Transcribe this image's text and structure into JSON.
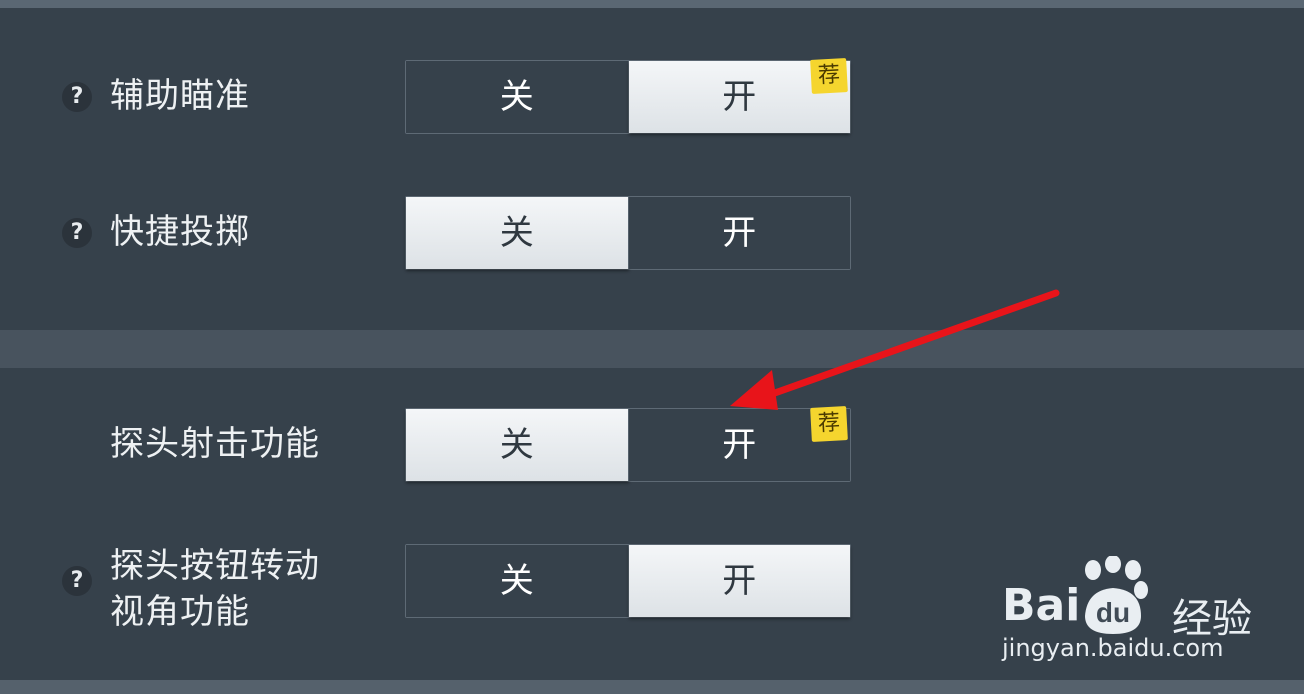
{
  "settings": [
    {
      "label_lines": [
        "辅助瞄准"
      ],
      "help": "?",
      "off": "关",
      "on": "开",
      "selected": "on",
      "badge": "荐"
    },
    {
      "label_lines": [
        "快捷投掷"
      ],
      "help": "?",
      "off": "关",
      "on": "开",
      "selected": "off",
      "badge": ""
    },
    {
      "label_lines": [
        "探头射击功能"
      ],
      "help": "",
      "off": "关",
      "on": "开",
      "selected": "off",
      "badge": "荐"
    },
    {
      "label_lines": [
        "探头按钮转动",
        "视角功能"
      ],
      "help": "?",
      "off": "关",
      "on": "开",
      "selected": "on",
      "badge": ""
    }
  ],
  "annotation": {
    "type": "red-arrow",
    "color": "#e8141a",
    "target": "探头射击功能 开"
  },
  "watermark": {
    "logo_text": "Bai",
    "logo_suffix": "du",
    "brand": "经验",
    "url": "jingyan.baidu.com"
  }
}
